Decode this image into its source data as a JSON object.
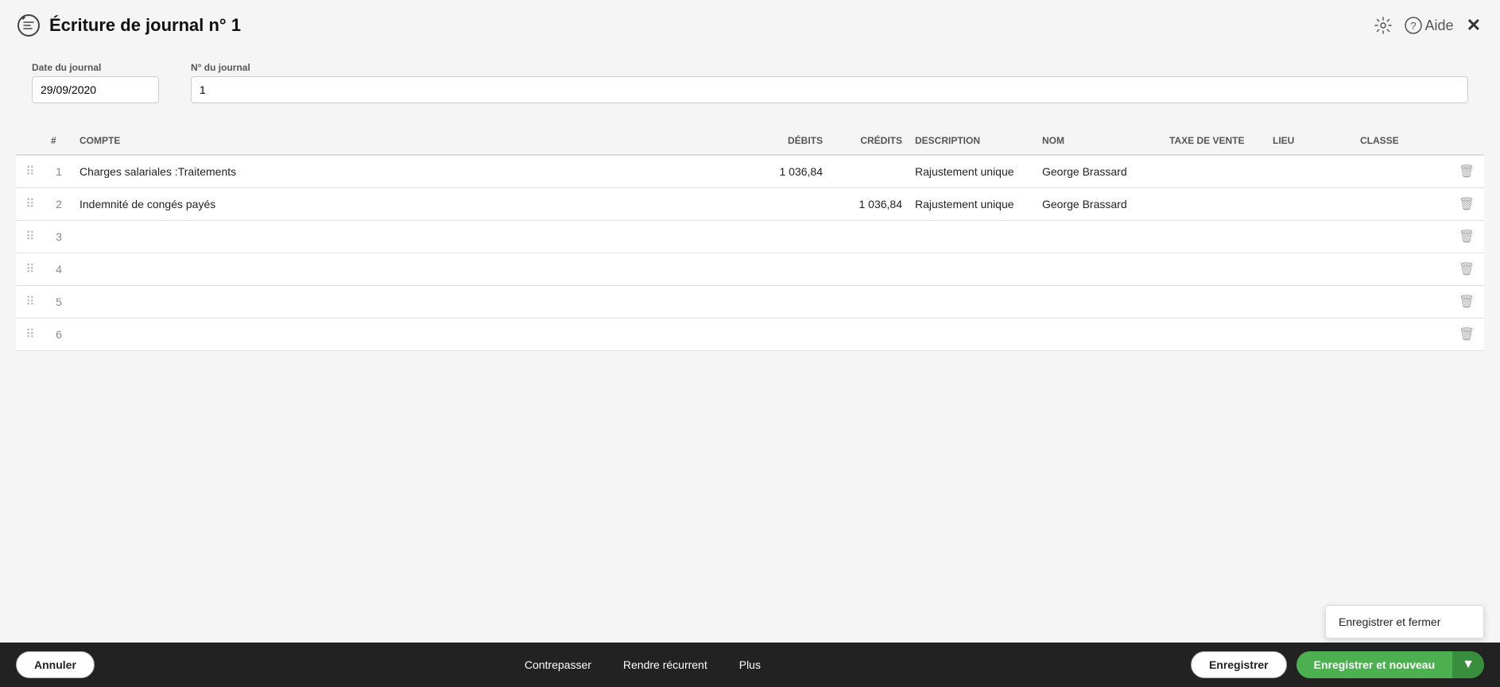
{
  "header": {
    "icon": "journal-icon",
    "title": "Écriture de journal n° 1",
    "settings_label": "⚙",
    "help_label": "Aide",
    "close_label": "✕"
  },
  "form": {
    "date_label": "Date du journal",
    "date_value": "29/09/2020",
    "journal_num_label": "N° du journal",
    "journal_num_value": "1"
  },
  "table": {
    "columns": [
      {
        "key": "drag",
        "label": ""
      },
      {
        "key": "num",
        "label": "#"
      },
      {
        "key": "compte",
        "label": "COMPTE"
      },
      {
        "key": "debits",
        "label": "DÉBITS",
        "align": "right"
      },
      {
        "key": "credits",
        "label": "CRÉDITS",
        "align": "right"
      },
      {
        "key": "description",
        "label": "DESCRIPTION"
      },
      {
        "key": "nom",
        "label": "NOM"
      },
      {
        "key": "taxe_vente",
        "label": "TAXE DE VENTE"
      },
      {
        "key": "lieu",
        "label": "LIEU"
      },
      {
        "key": "classe",
        "label": "CLASSE"
      },
      {
        "key": "delete",
        "label": ""
      }
    ],
    "rows": [
      {
        "num": "1",
        "compte": "Charges salariales :Traitements",
        "debits": "1 036,84",
        "credits": "",
        "description": "Rajustement unique",
        "nom": "George Brassard",
        "taxe_vente": "",
        "lieu": "",
        "classe": ""
      },
      {
        "num": "2",
        "compte": "Indemnité de congés payés",
        "debits": "",
        "credits": "1 036,84",
        "description": "Rajustement unique",
        "nom": "George Brassard",
        "taxe_vente": "",
        "lieu": "",
        "classe": ""
      },
      {
        "num": "3",
        "compte": "",
        "debits": "",
        "credits": "",
        "description": "",
        "nom": "",
        "taxe_vente": "",
        "lieu": "",
        "classe": ""
      },
      {
        "num": "4",
        "compte": "",
        "debits": "",
        "credits": "",
        "description": "",
        "nom": "",
        "taxe_vente": "",
        "lieu": "",
        "classe": ""
      },
      {
        "num": "5",
        "compte": "",
        "debits": "",
        "credits": "",
        "description": "",
        "nom": "",
        "taxe_vente": "",
        "lieu": "",
        "classe": ""
      },
      {
        "num": "6",
        "compte": "",
        "debits": "",
        "credits": "",
        "description": "",
        "nom": "",
        "taxe_vente": "",
        "lieu": "",
        "classe": ""
      }
    ]
  },
  "footer": {
    "annuler_label": "Annuler",
    "contrepasser_label": "Contrepasser",
    "rendre_recurrent_label": "Rendre récurrent",
    "plus_label": "Plus",
    "enregistrer_label": "Enregistrer",
    "enregistrer_nouveau_label": "Enregistrer et nouveau",
    "enregistrer_fermer_label": "Enregistrer et fermer"
  }
}
